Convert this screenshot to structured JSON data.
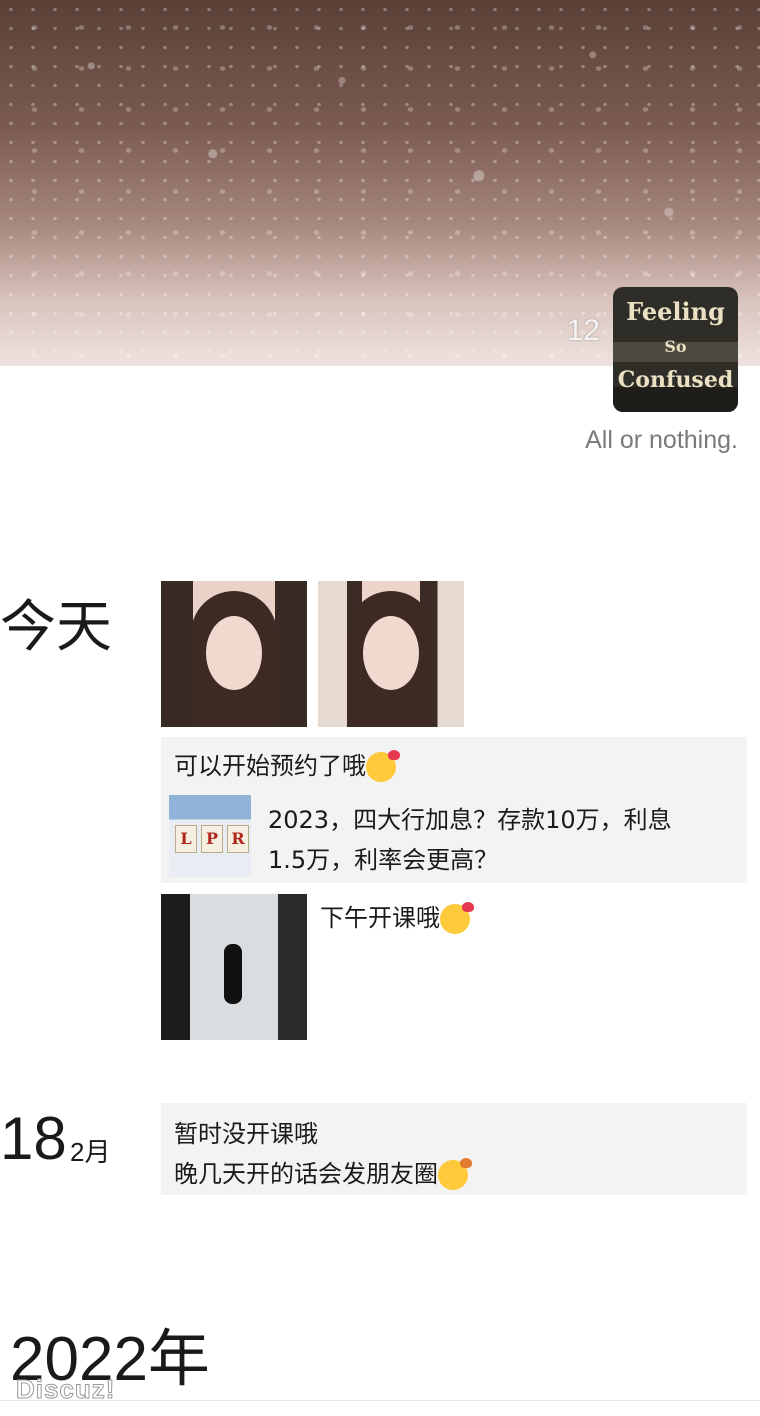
{
  "header": {
    "likes_count": "12",
    "avatar_text_line1": "Feeling",
    "avatar_text_line2": "So",
    "avatar_text_line3": "Confused",
    "signature": "All or nothing."
  },
  "groups": [
    {
      "label": "今天",
      "posts": [
        {
          "type": "photos",
          "count": 2
        },
        {
          "type": "text_with_link",
          "text": "可以开始预约了哦",
          "emoji": "smiling-face-with-hearts",
          "link_title_line1": "2023，四大行加息？存款10万，利息",
          "link_title_line2": "1.5万，利率会更高？",
          "link_thumb_letters": [
            "L",
            "P",
            "R"
          ]
        },
        {
          "type": "photo_with_text",
          "text": "下午开课哦",
          "emoji": "smiling-face-with-hearts"
        }
      ]
    },
    {
      "day": "18",
      "month": "2月",
      "posts": [
        {
          "type": "text",
          "line1": "暂时没开课哦",
          "line2": "晚几天开的话会发朋友圈",
          "emoji": "face-blowing-a-kiss"
        }
      ]
    }
  ],
  "year_header": "2022年",
  "watermark": "Discuz!",
  "colors": {
    "background": "#ffffff",
    "entry_bg": "#f3f3f3",
    "signature": "#7a7a7a"
  }
}
